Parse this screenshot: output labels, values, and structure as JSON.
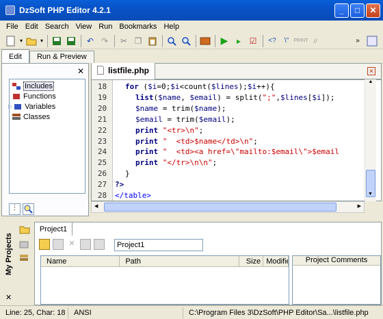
{
  "window": {
    "title": "DzSoft PHP Editor 4.2.1"
  },
  "menu": [
    "File",
    "Edit",
    "Search",
    "View",
    "Run",
    "Bookmarks",
    "Help"
  ],
  "left_tabs": [
    "Edit",
    "Run & Preview"
  ],
  "tree": [
    "Includes",
    "Functions",
    "Variables",
    "Classes"
  ],
  "editor": {
    "filename": "listfile.php",
    "lines": [
      {
        "n": "18",
        "code": "for ($i=0;$i<count($lines);$i++){",
        "indent": 1
      },
      {
        "n": "19",
        "code": "list($name, $email) = split(\";\",$lines[$i]);",
        "indent": 2
      },
      {
        "n": "20",
        "code": "$name = trim($name);",
        "indent": 2
      },
      {
        "n": "21",
        "code": "$email = trim($email);",
        "indent": 2
      },
      {
        "n": "22",
        "code": "print \"<tr>\\n\";",
        "indent": 2
      },
      {
        "n": "23",
        "code": "print \"  <td>$name</td>\\n\";",
        "indent": 2
      },
      {
        "n": "24",
        "code": "print \"  <td><a href=\\\"mailto:$email\\\">$email",
        "indent": 2
      },
      {
        "n": "25",
        "code": "print \"</tr>\\n\\n\";",
        "indent": 2
      },
      {
        "n": "26",
        "code": "}",
        "indent": 1
      },
      {
        "n": "27",
        "code": "?>",
        "indent": 0
      },
      {
        "n": "28",
        "code": "</table>",
        "indent": 0
      }
    ]
  },
  "projects": {
    "sidebar_label": "My Projects",
    "tab": "Project1",
    "name_field": "Project1",
    "columns": [
      "Name",
      "Path",
      "Size",
      "Modified"
    ],
    "comments_header": "Project Comments"
  },
  "status": {
    "position": "Line: 25, Char: 18",
    "encoding": "ANSI",
    "path": "C:\\Program Files 3\\DzSoft\\PHP Editor\\Sa...\\listfile.php"
  },
  "colors": {
    "titlebar": "#0a5fd8",
    "keyword": "#000080",
    "string": "#cc0000",
    "tag": "#0000ff"
  }
}
